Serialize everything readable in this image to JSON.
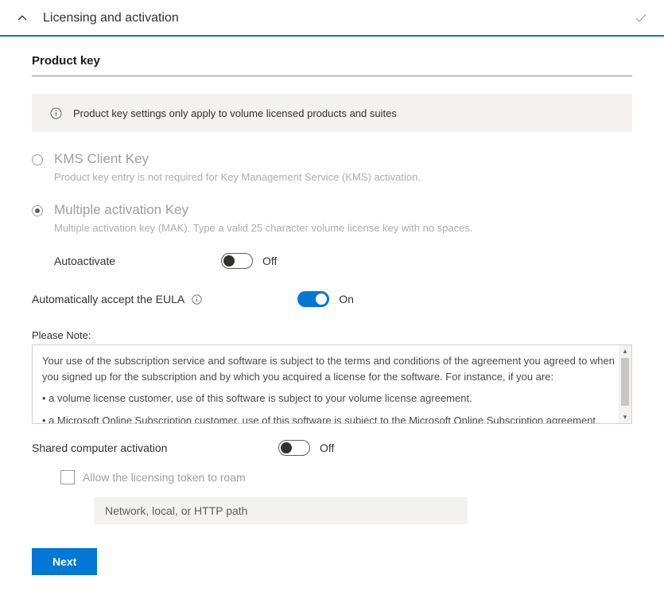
{
  "header": {
    "title": "Licensing and activation"
  },
  "section": {
    "title": "Product key"
  },
  "info": {
    "text": "Product key settings only apply to volume licensed products and suites"
  },
  "radios": {
    "kms": {
      "label": "KMS Client Key",
      "desc": "Product key entry is not required for Key Management Service (KMS) activation."
    },
    "mak": {
      "label": "Multiple activation Key",
      "desc": "Multiple activation key (MAK). Type a valid 25 character volume license key with no spaces."
    }
  },
  "autoactivate": {
    "label": "Autoactivate",
    "state": "Off"
  },
  "eula": {
    "label": "Automatically accept the EULA",
    "state": "On"
  },
  "note": {
    "label": "Please Note:",
    "p1": "Your use of the subscription service and software is subject to the terms and conditions of the agreement you agreed to when you signed up for the subscription and by which you acquired a license for the software. For instance, if you are:",
    "b1": "• a volume license customer, use of this software is subject to your volume license agreement.",
    "b2": "• a Microsoft Online Subscription customer, use of this software is subject to the Microsoft Online Subscription agreement."
  },
  "shared": {
    "label": "Shared computer activation",
    "state": "Off"
  },
  "roam": {
    "label": "Allow the licensing token to roam",
    "placeholder": "Network, local, or HTTP path"
  },
  "buttons": {
    "next": "Next"
  }
}
